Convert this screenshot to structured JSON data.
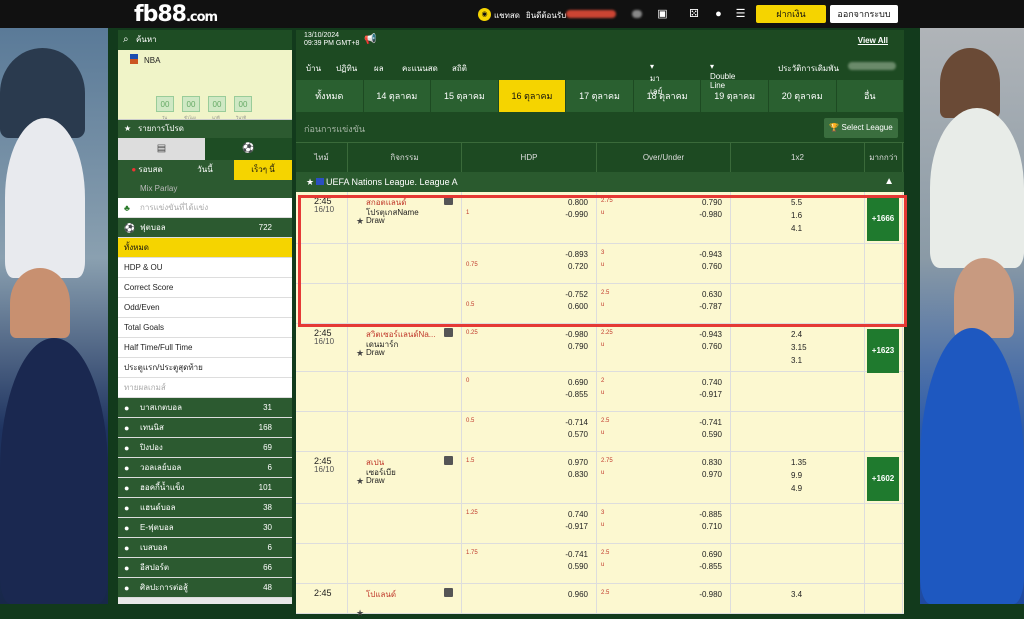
{
  "brand": {
    "logo": "fb88",
    "domain": ".com"
  },
  "topbar": {
    "chat": "แชทสด",
    "welcome": "ยินดีต้อนรับ",
    "deposit": "ฝากเงิน",
    "logout": "ออกจากระบบ"
  },
  "sidebar": {
    "search": "ค้นหา",
    "nba": {
      "label": "NBA",
      "countdown": [
        "00",
        "00",
        "00",
        "00"
      ],
      "units": [
        "วัน",
        "ชั่วโมง",
        "นาที",
        "วินาที"
      ]
    },
    "favorites": "รายการโปรด",
    "tabs3": [
      "รอบสด",
      "วันนี้",
      "เร็วๆ นี้"
    ],
    "mix_parlay": "Mix Parlay",
    "upcoming": "การแข่งขันที่ได้แข่ง",
    "football": {
      "label": "ฟุตบอล",
      "count": "722"
    },
    "bet_types": [
      "ทั้งหมด",
      "HDP & OU",
      "Correct Score",
      "Odd/Even",
      "Total Goals",
      "Half Time/Full Time",
      "ประตูแรก/ประตูสุดท้าย",
      "ทายผลเกมส์"
    ],
    "sports": [
      {
        "label": "บาสเกตบอล",
        "count": "31"
      },
      {
        "label": "เทนนิส",
        "count": "168"
      },
      {
        "label": "ปิงปอง",
        "count": "69"
      },
      {
        "label": "วอลเลย์บอล",
        "count": "6"
      },
      {
        "label": "ฮอคกี้น้ำแข็ง",
        "count": "101"
      },
      {
        "label": "แฮนด์บอล",
        "count": "38"
      },
      {
        "label": "E-ฟุตบอล",
        "count": "30"
      },
      {
        "label": "เบสบอล",
        "count": "6"
      },
      {
        "label": "อีสปอร์ต",
        "count": "66"
      },
      {
        "label": "ศิลปะการต่อสู้",
        "count": "48"
      }
    ]
  },
  "main": {
    "date": "13/10/2024",
    "time": "09:39 PM GMT+8",
    "view_all": "View All",
    "nav": [
      "บ้าน",
      "ปฏิทิน",
      "ผล",
      "คะแนนสด",
      "สถิติ"
    ],
    "lang": "มาเลย์",
    "odds_type": "Double Line",
    "history": "ประวัติการเดิมพัน",
    "day_tabs": [
      "ทั้งหมด",
      "14 ตุลาคม",
      "15 ตุลาคม",
      "16 ตุลาคม",
      "17 ตุลาคม",
      "18 ตุลาคม",
      "19 ตุลาคม",
      "20 ตุลาคม",
      "อื่น"
    ],
    "section": "ก่อนการแข่งขัน",
    "select_league": "Select League",
    "columns": [
      "ไทม์",
      "กิจกรรม",
      "HDP",
      "Over/Under",
      "1x2",
      "มากกว่า"
    ],
    "league": "UEFA Nations League. League A",
    "matches": [
      {
        "time": "2:45",
        "date": "16/10",
        "home": "สกอตแลนด์",
        "away": "โปรตุเกสName",
        "draw": "Draw",
        "more": "+1666",
        "lines": [
          {
            "hdp": "",
            "hdp2": "1",
            "h1": "0.800",
            "h2": "-0.990",
            "ou1": "2.75",
            "ou2": "u",
            "o1": "0.790",
            "o2": "-0.980",
            "x": [
              "5.5",
              "1.6",
              "4.1"
            ]
          },
          {
            "hdp": "",
            "hdp2": "0.75",
            "h1": "-0.893",
            "h2": "0.720",
            "ou1": "3",
            "ou2": "u",
            "o1": "-0.943",
            "o2": "0.760"
          },
          {
            "hdp": "",
            "hdp2": "0.5",
            "h1": "-0.752",
            "h2": "0.600",
            "ou1": "2.5",
            "ou2": "u",
            "o1": "0.630",
            "o2": "-0.787"
          }
        ]
      },
      {
        "time": "2:45",
        "date": "16/10",
        "home": "สวิตเซอร์แลนด์Na...",
        "away": "เดนมาร์ก",
        "draw": "Draw",
        "more": "+1623",
        "lines": [
          {
            "hdp": "0.25",
            "hdp2": "",
            "h1": "-0.980",
            "h2": "0.790",
            "ou1": "2.25",
            "ou2": "u",
            "o1": "-0.943",
            "o2": "0.760",
            "x": [
              "2.4",
              "3.15",
              "3.1"
            ]
          },
          {
            "hdp": "0",
            "hdp2": "",
            "h1": "0.690",
            "h2": "-0.855",
            "ou1": "2",
            "ou2": "u",
            "o1": "0.740",
            "o2": "-0.917"
          },
          {
            "hdp": "0.5",
            "hdp2": "",
            "h1": "-0.714",
            "h2": "0.570",
            "ou1": "2.5",
            "ou2": "u",
            "o1": "-0.741",
            "o2": "0.590"
          }
        ]
      },
      {
        "time": "2:45",
        "date": "16/10",
        "home": "สเปน",
        "away": "เซอร์เบีย",
        "draw": "Draw",
        "more": "+1602",
        "lines": [
          {
            "hdp": "1.5",
            "hdp2": "",
            "h1": "0.970",
            "h2": "0.830",
            "ou1": "2.75",
            "ou2": "u",
            "o1": "0.830",
            "o2": "0.970",
            "x": [
              "1.35",
              "9.9",
              "4.9"
            ]
          },
          {
            "hdp": "1.25",
            "hdp2": "",
            "h1": "0.740",
            "h2": "-0.917",
            "ou1": "3",
            "ou2": "u",
            "o1": "-0.885",
            "o2": "0.710"
          },
          {
            "hdp": "1.75",
            "hdp2": "",
            "h1": "-0.741",
            "h2": "0.590",
            "ou1": "2.5",
            "ou2": "u",
            "o1": "0.690",
            "o2": "-0.855"
          }
        ]
      },
      {
        "time": "2:45",
        "date": "",
        "home": "โปแลนด์",
        "away": "",
        "draw": "",
        "more": "",
        "lines": [
          {
            "hdp": "",
            "hdp2": "",
            "h1": "0.960",
            "h2": "",
            "ou1": "2.5",
            "ou2": "",
            "o1": "-0.980",
            "o2": "",
            "x": [
              "3.4"
            ]
          }
        ]
      }
    ]
  }
}
